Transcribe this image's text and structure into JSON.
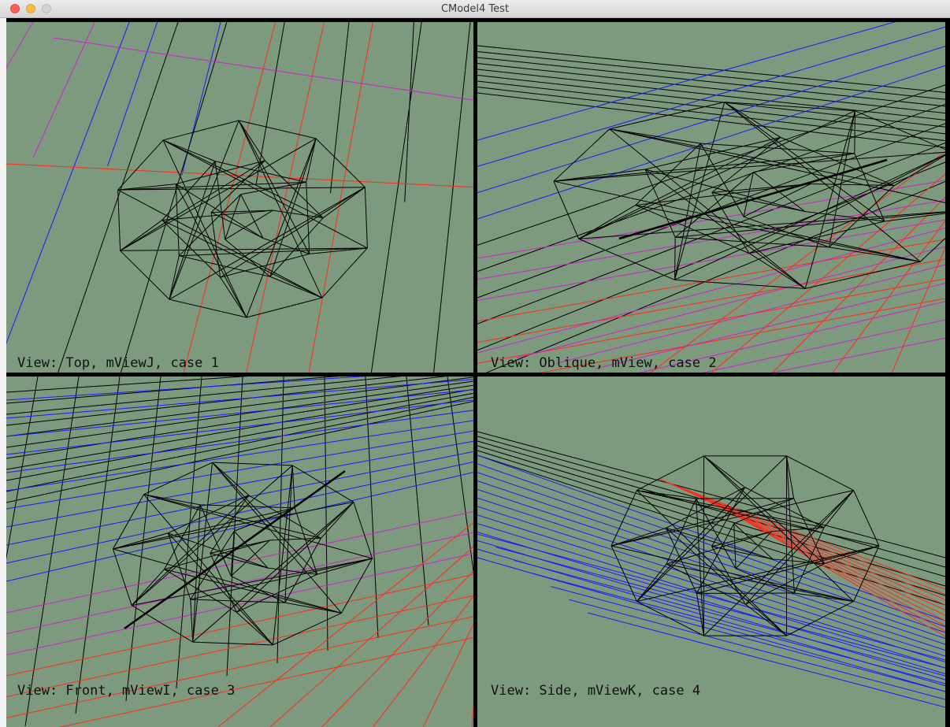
{
  "window": {
    "title": "CModel4 Test"
  },
  "colors": {
    "background": "#7e9a7e",
    "mesh": "#000000",
    "x_axis": "#ff2a1a",
    "y_axis": "#cc22cc",
    "z_axis": "#1a1aff"
  },
  "viewports": [
    {
      "label": "View: Top, mViewJ, case 1"
    },
    {
      "label": "View: Oblique, mView, case 2"
    },
    {
      "label": "View: Front, mViewI, case 3"
    },
    {
      "label": "View: Side, mViewK, case 4"
    }
  ]
}
